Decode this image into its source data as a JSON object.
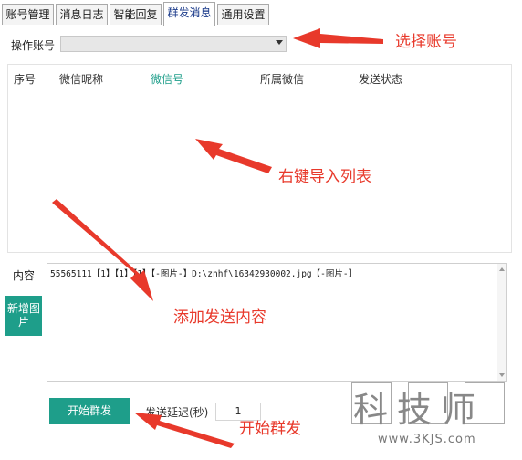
{
  "tabs": [
    {
      "label": "账号管理"
    },
    {
      "label": "消息日志"
    },
    {
      "label": "智能回复"
    },
    {
      "label": "群发消息"
    },
    {
      "label": "通用设置"
    }
  ],
  "active_tab": "群发消息",
  "account": {
    "label": "操作账号",
    "value": ""
  },
  "list": {
    "columns": [
      "序号",
      "微信昵称",
      "微信号",
      "所属微信",
      "发送状态"
    ],
    "rows": []
  },
  "content": {
    "label": "内容",
    "text": "55565111【1】【1】【1】【-图片-】D:\\znhf\\16342930002.jpg【-图片-】"
  },
  "buttons": {
    "add_image": "新增图片",
    "start": "开始群发"
  },
  "delay": {
    "label": "发送延迟(秒)",
    "value": "1"
  },
  "annotations": {
    "select_account": "选择账号",
    "import_list": "右键导入列表",
    "add_content": "添加发送内容",
    "start_send": "开始群发"
  },
  "watermark": {
    "text": "科技师",
    "url": "www.3KJS.com"
  },
  "colors": {
    "accent": "#1e9e8a",
    "annotation": "#e8392b",
    "active_column": "#1e9e8a"
  }
}
